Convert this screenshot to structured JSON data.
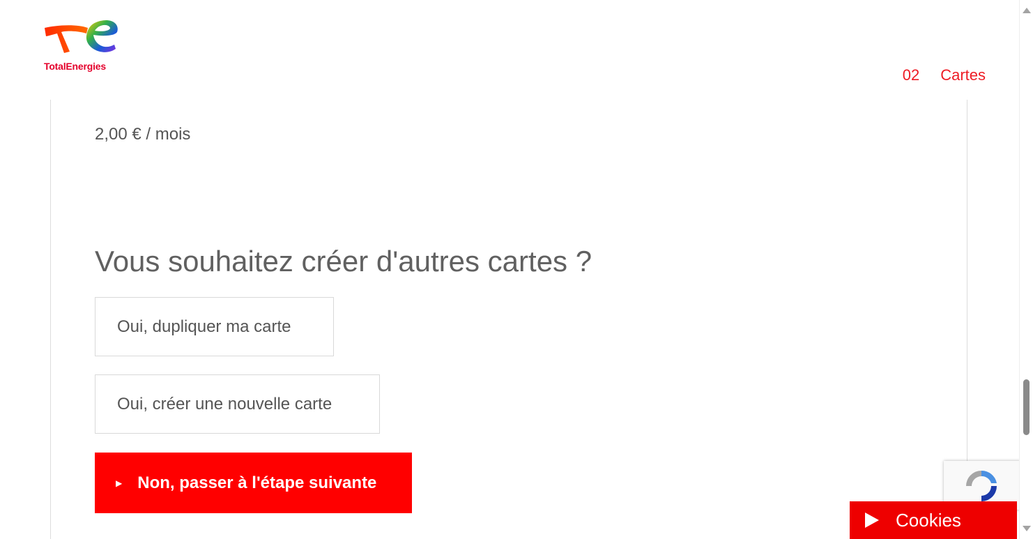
{
  "header": {
    "logo_text": "TotalEnergies",
    "step_number": "02",
    "step_label": "Cartes"
  },
  "main": {
    "price": "2,00 € / mois",
    "question": "Vous souhaitez créer d'autres cartes ?",
    "duplicate_label": "Oui, dupliquer ma carte",
    "new_card_label": "Oui, créer une nouvelle carte",
    "next_label": "Non, passer à l'étape suivante"
  },
  "cookies": {
    "label": "Cookies"
  },
  "colors": {
    "brand_red": "#ff0000",
    "text_gray": "#606060"
  },
  "icons": {
    "logo": "totalenergies-logo",
    "next_arrow": "play-triangle-icon",
    "cookies": "play-icon",
    "recaptcha": "recaptcha-icon"
  }
}
